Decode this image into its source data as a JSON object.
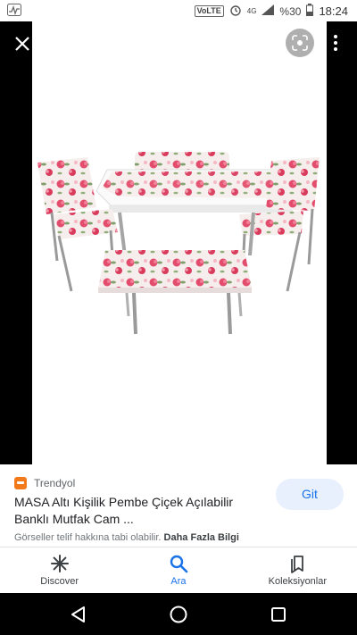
{
  "status_bar": {
    "carrier_badge": "VoLTE",
    "network": "4G",
    "battery": "%30",
    "time": "18:24"
  },
  "viewer": {
    "close_icon": "close-icon",
    "lens_icon": "lens-icon",
    "more_icon": "more-vert-icon"
  },
  "result": {
    "source": "Trendyol",
    "title": "MASA Altı Kişilik Pembe Çiçek Açılabilir Banklı Mutfak Cam ...",
    "visit_label": "Git",
    "copyright_text": "Görseller telif hakkına tabi olabilir.",
    "more_info": "Daha Fazla Bilgi"
  },
  "bottom_nav": {
    "items": [
      {
        "label": "Discover",
        "icon": "asterisk-icon"
      },
      {
        "label": "Ara",
        "icon": "search-icon"
      },
      {
        "label": "Koleksiyonlar",
        "icon": "bookmarks-icon"
      }
    ]
  },
  "colors": {
    "accent": "#1a73e8",
    "visit_button_bg": "#e8f0fe",
    "source_brand": "#f27a1a"
  }
}
